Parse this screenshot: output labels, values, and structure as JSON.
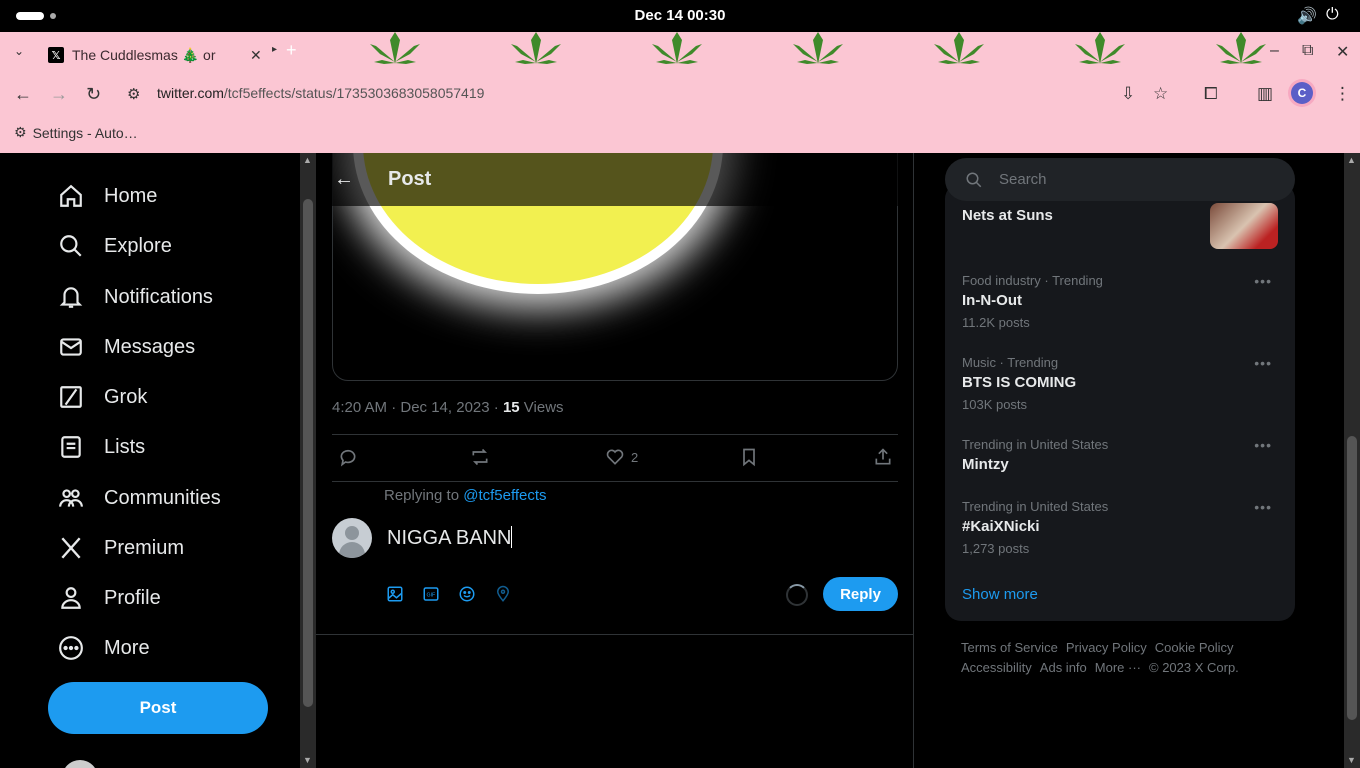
{
  "system": {
    "clock": "Dec 14  00:30",
    "volume_icon": "volume-icon",
    "power_icon": "power-icon"
  },
  "browser": {
    "tab_title": "The Cuddlesmas 🎄   or",
    "tab_close": "✕",
    "new_tab": "+",
    "url_host": "twitter.com",
    "url_path": "/tcf5effects/status/1735303683058057419",
    "bookmark": "Settings - Auto…",
    "profile_initial": "C",
    "theme_color": "#fbc6d3"
  },
  "nav": {
    "items": [
      {
        "label": "Home",
        "icon": "home-icon"
      },
      {
        "label": "Explore",
        "icon": "search-icon"
      },
      {
        "label": "Notifications",
        "icon": "bell-icon"
      },
      {
        "label": "Messages",
        "icon": "mail-icon"
      },
      {
        "label": "Grok",
        "icon": "grok-icon"
      },
      {
        "label": "Lists",
        "icon": "list-icon"
      },
      {
        "label": "Communities",
        "icon": "people-icon"
      },
      {
        "label": "Premium",
        "icon": "x-logo-icon"
      },
      {
        "label": "Profile",
        "icon": "person-icon"
      },
      {
        "label": "More",
        "icon": "more-circle-icon"
      }
    ],
    "post_button": "Post"
  },
  "main": {
    "header_title": "Post",
    "meta_time": "4:20 AM · Dec 14, 2023 · ",
    "views_count": "15",
    "views_label": " Views",
    "like_count": "2",
    "replying_prefix": "Replying to ",
    "replying_handle": "@tcf5effects",
    "reply_text": "NIGGA BANN",
    "reply_button": "Reply",
    "accent": "#1d9bf0"
  },
  "sidebar": {
    "search_placeholder": "Search",
    "trends": [
      {
        "context": "",
        "name": "Nets at Suns",
        "count": ""
      },
      {
        "context": "Food industry · Trending",
        "name": "In-N-Out",
        "count": "11.2K posts"
      },
      {
        "context": "Music · Trending",
        "name": "BTS IS COMING",
        "count": "103K posts"
      },
      {
        "context": "Trending in United States",
        "name": "Mintzy",
        "count": ""
      },
      {
        "context": "Trending in United States",
        "name": "#KaiXNicki",
        "count": "1,273 posts"
      }
    ],
    "show_more": "Show more",
    "footer": [
      "Terms of Service",
      "Privacy Policy",
      "Cookie Policy",
      "Accessibility",
      "Ads info",
      "More ···",
      "© 2023 X Corp."
    ]
  }
}
